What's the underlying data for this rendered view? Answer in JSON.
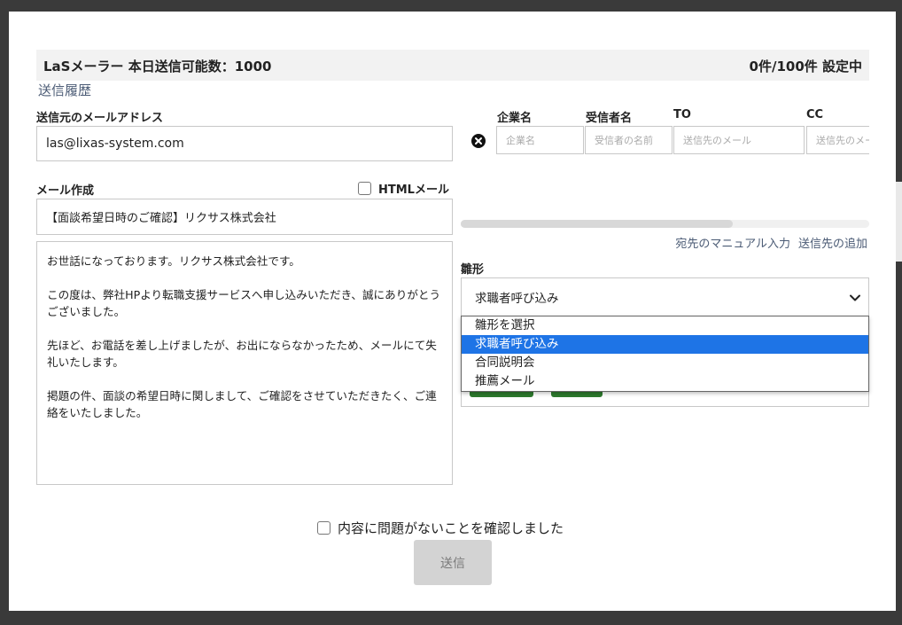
{
  "header": {
    "app_title": "LaSメーラー 本日送信可能数：1000",
    "status": "0件/100件 設定中"
  },
  "history_link": "送信履歴",
  "sender": {
    "label": "送信元のメールアドレス",
    "value": "las@lixas-system.com"
  },
  "compose": {
    "label": "メール作成",
    "html_toggle_label": "HTMLメール",
    "html_checked": false,
    "subject": "【面談希望日時のご確認】リクサス株式会社",
    "body": "お世話になっております。リクサス株式会社です。\n\nこの度は、弊社HPより転職支援サービスへ申し込みいただき、誠にありがとうございました。\n\n先ほど、お電話を差し上げましたが、お出にならなかったため、メールにて失礼いたします。\n\n掲題の件、面談の希望日時に関しまして、ご確認をさせていただきたく、ご連絡をいたしました。"
  },
  "recipients": {
    "columns": [
      {
        "label": "企業名",
        "placeholder": "企業名"
      },
      {
        "label": "受信者名",
        "placeholder": "受信者の名前"
      },
      {
        "label": "TO",
        "placeholder": "送信先のメール"
      },
      {
        "label": "CC",
        "placeholder": "送信先のメー"
      }
    ],
    "manual_input_link": "宛先のマニュアル入力",
    "add_recipient_link": "送信先の追加"
  },
  "template": {
    "label": "雛形",
    "selected": "求職者呼び込み",
    "options": [
      "雛形を選択",
      "求職者呼び込み",
      "合同説明会",
      "推薦メール"
    ],
    "highlighted_index": 1
  },
  "confirm": {
    "label": "内容に問題がないことを確認しました",
    "checked": false
  },
  "send_button": "送信",
  "colors": {
    "link": "#4b5b75",
    "highlight": "#1e74e6",
    "header_bg": "#f2f2f2",
    "disabled_button": "#d3d3d3",
    "green_button": "#2d7a2d"
  }
}
